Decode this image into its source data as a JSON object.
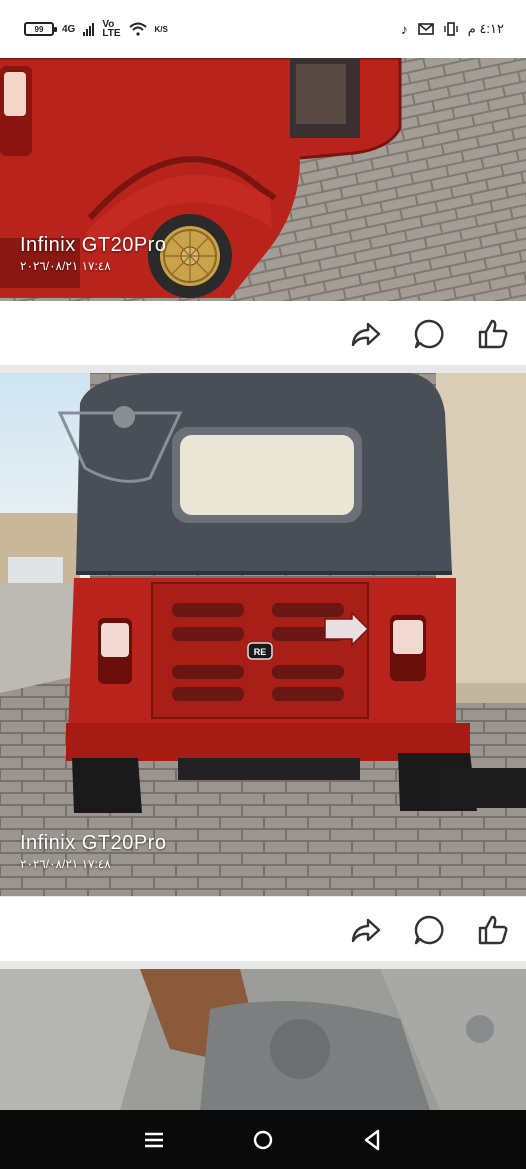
{
  "status_bar": {
    "battery_level": "99",
    "network_4g": "4G",
    "network_volte_top": "Vo",
    "network_volte_bottom": "LTE",
    "data_speed": "K/S",
    "clock": "٤:١٢ م"
  },
  "posts": [
    {
      "watermark_brand": "Infinix GT20Pro",
      "watermark_timestamp": "١٧:٤٨ ٢٠٢٦/٠٨/٢١"
    },
    {
      "watermark_brand": "Infinix GT20Pro",
      "watermark_timestamp": "١٧:٤٨ ٢٠٢٦/٠٨/٢١"
    }
  ],
  "rickshaw_badge": "RE",
  "icons": {
    "share": "share-icon",
    "comment": "comment-icon",
    "like": "like-icon",
    "nav_menu": "recents-icon",
    "nav_home": "home-icon",
    "nav_back": "back-icon"
  },
  "colors": {
    "vehicle_red": "#b8231c",
    "canopy": "#4a4e57",
    "pavement": "#9a958e",
    "nav_bar": "#0a0a0a"
  }
}
